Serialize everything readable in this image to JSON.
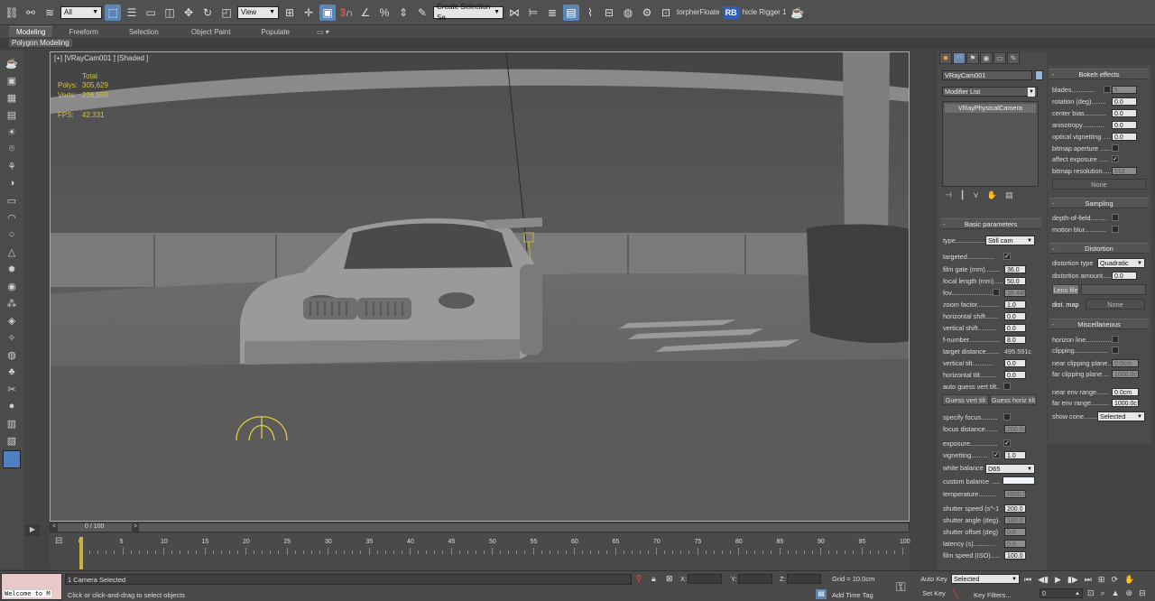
{
  "toolbar": {
    "selection_filter": "All",
    "ref_coord": "View",
    "snap_number": "3",
    "named_selection": "Create Selection Se",
    "plugin_a": "torpherFloate",
    "rb_badge": "RB",
    "plugin_b": "hicle Rigger 1"
  },
  "ribbon": {
    "tabs": [
      "Modeling",
      "Freeform",
      "Selection",
      "Object Paint",
      "Populate"
    ],
    "sub_tab": "Polygon Modeling"
  },
  "viewport": {
    "label": "[+] [VRayCam001 ] [Shaded ]",
    "stats": {
      "total_label": "Total",
      "polys_label": "Polys:",
      "polys_value": "305,629",
      "verts_label": "Verts:",
      "verts_value": "236,559",
      "fps_label": "FPS:",
      "fps_value": "42.331"
    }
  },
  "timeline": {
    "slider_label": "0 / 100",
    "ticks": [
      "0",
      "5",
      "10",
      "15",
      "20",
      "25",
      "30",
      "35",
      "40",
      "45",
      "50",
      "55",
      "60",
      "65",
      "70",
      "75",
      "80",
      "85",
      "90",
      "95",
      "100"
    ]
  },
  "command_panel": {
    "object_name": "VRayCam001",
    "modifier_list": "Modifier List",
    "stack_item": "VRayPhysicalCamera",
    "basic": {
      "title": "Basic parameters",
      "type_label": "type.................",
      "type_value": "Still cam",
      "targeted": "targeted...............",
      "film_gate": "film gate (mm)........",
      "film_gate_v": "36.0",
      "focal_length": "focal length (mm).....",
      "focal_length_v": "50.0",
      "fov": "fov.......................",
      "fov_v": "39.445",
      "zoom": "zoom factor............",
      "zoom_v": "1.0",
      "hshift": "horizontal shift.......",
      "hshift_v": "0.0",
      "vshift": "vertical shift..........",
      "vshift_v": "0.0",
      "fnumber": "f-number.................",
      "fnumber_v": "8.0",
      "target_dist": "target distance.......",
      "target_dist_v": "495.591c",
      "vtilt": "vertical tilt............",
      "vtilt_v": "0.0",
      "htilt": "horizontal tilt.........",
      "htilt_v": "0.0",
      "auto_guess": "auto guess vert tilt..",
      "guess_vert": "Guess vert tilt",
      "guess_horiz": "Guess horiz tilt",
      "spec_focus": "specify focus.........",
      "focus_dist": "focus distance.......",
      "focus_dist_v": "200.0cr",
      "exposure": "exposure...............",
      "vignetting": "vignetting.........",
      "vignetting_v": "1.0",
      "wb": "white balance",
      "wb_v": "D65",
      "custom_balance": "custom balance .....",
      "temperature": "temperature..........",
      "temperature_v": "6500.0",
      "shutter_speed": "shutter speed (s^-1",
      "shutter_speed_v": "200.0",
      "shutter_angle": "shutter angle (deg).",
      "shutter_angle_v": "180.0",
      "shutter_offset": "shutter offset (deg)",
      "shutter_offset_v": "0.0",
      "latency": "latency (s)............",
      "latency_v": "0.0",
      "film_speed": "film speed (ISO).....",
      "film_speed_v": "100.0"
    },
    "bokeh": {
      "title": "Bokeh effects",
      "blades": "blades.............",
      "blades_v": "5",
      "rotation": "rotation (deg)........",
      "rotation_v": "0.0",
      "center_bias": "center bias............",
      "center_bias_v": "0.0",
      "anisotropy": "anisotropy............",
      "anisotropy_v": "0.0",
      "optical_vig": "optical vignetting ....",
      "optical_vig_v": "0.0",
      "bitmap_aperture": "bitmap aperture ......",
      "affect_exposure": "affect exposure .....",
      "bitmap_res": "bitmap resolution.....",
      "bitmap_res_v": "512",
      "none_btn": "None"
    },
    "sampling": {
      "title": "Sampling",
      "dof": "depth-of-field.........",
      "motion_blur": "motion blur............"
    },
    "distortion": {
      "title": "Distortion",
      "type_label": "distortion type",
      "type_value": "Quadratic",
      "amount": "distortion amount.....",
      "amount_v": "0.0",
      "lens_file": "Lens file",
      "dist_map": "dist. map",
      "none_btn": "None"
    },
    "misc": {
      "title": "Miscellaneous",
      "horizon": "horizon line..............",
      "clipping": "clipping..................",
      "near_clip": "near clipping plane..",
      "near_clip_v": "0.0cm",
      "far_clip": "far clipping plane....",
      "far_clip_v": "1000.0c",
      "near_env": "near env range.......",
      "near_env_v": "0.0cm",
      "far_env": "far env range..........",
      "far_env_v": "1000.0c",
      "show_cone": "show cone........",
      "show_cone_v": "Selected"
    }
  },
  "status": {
    "listener": "Welcome to M",
    "selected": "1 Camera Selected",
    "prompt": "Click or click-and-drag to select objects",
    "x_label": "X:",
    "y_label": "Y:",
    "z_label": "Z:",
    "grid": "Grid = 10.0cm",
    "add_time_tag": "Add Time Tag",
    "auto_key": "Auto Key",
    "set_key": "Set Key",
    "key_mode": "Selected",
    "key_filters": "Key Filters...",
    "frame": "0"
  }
}
